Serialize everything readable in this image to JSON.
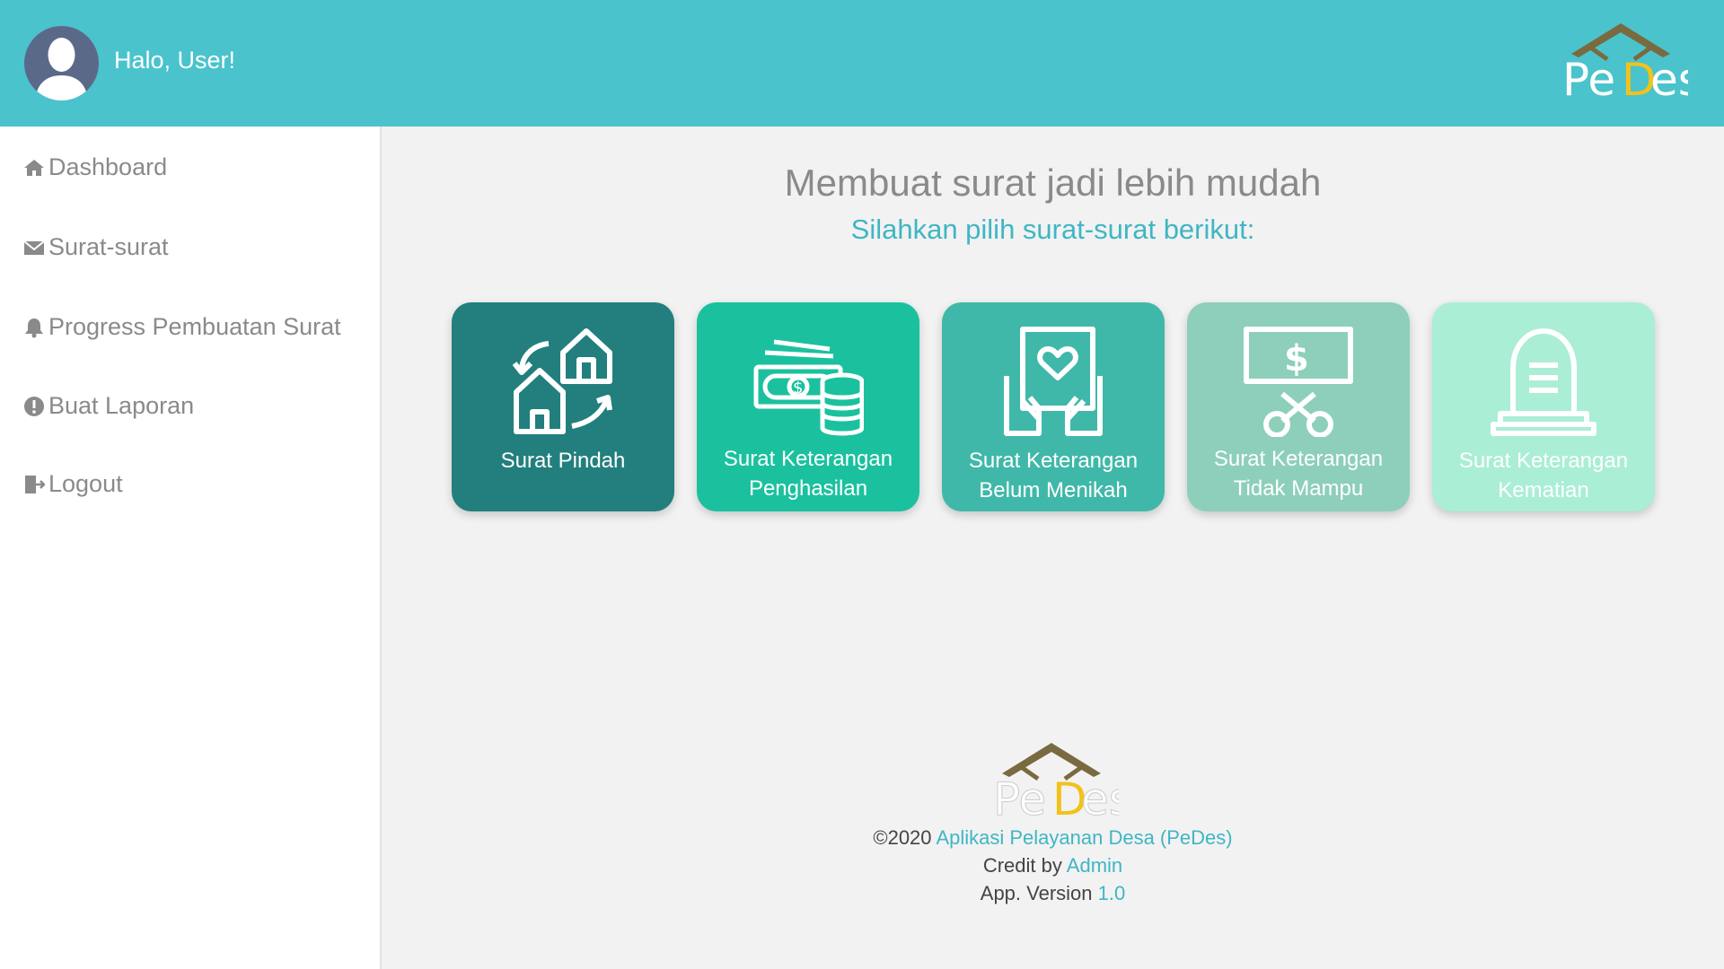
{
  "header": {
    "greeting": "Halo, User!",
    "logo_text": "PeDes"
  },
  "sidebar": {
    "items": [
      {
        "label": "Dashboard",
        "icon": "home-icon"
      },
      {
        "label": "Surat-surat",
        "icon": "envelope-icon"
      },
      {
        "label": "Progress Pembuatan Surat",
        "icon": "bell-icon"
      },
      {
        "label": "Buat Laporan",
        "icon": "exclamation-circle-icon"
      },
      {
        "label": "Logout",
        "icon": "logout-icon"
      }
    ]
  },
  "main": {
    "title": "Membuat surat jadi lebih mudah",
    "subtitle": "Silahkan pilih surat-surat berikut:",
    "cards": [
      {
        "line1": "Surat Pindah",
        "line2": "",
        "icon": "moving-house-icon",
        "color": "#227f7e"
      },
      {
        "line1": "Surat Keterangan",
        "line2": "Penghasilan",
        "icon": "money-icon",
        "color": "#1bc19e"
      },
      {
        "line1": "Surat Keterangan",
        "line2": "Belum Menikah",
        "icon": "love-letter-icon",
        "color": "#40b8a9"
      },
      {
        "line1": "Surat Keterangan",
        "line2": "Tidak Mampu",
        "icon": "cut-money-icon",
        "color": "#8dcfbb"
      },
      {
        "line1": "Surat Keterangan",
        "line2": "Kematian",
        "icon": "gravestone-icon",
        "color": "#aaeed6"
      }
    ]
  },
  "footer": {
    "copyright_prefix": "©2020",
    "app_name": "Aplikasi Pelayanan Desa (PeDes)",
    "credit_prefix": "Credit by",
    "credit_name": "Admin",
    "version_prefix": "App. Version",
    "version": "1.0"
  },
  "colors": {
    "header": "#4ac3cc",
    "accent": "#3fb6c4",
    "logo_roof": "#7a6a3f",
    "logo_yellow": "#f2c21a"
  }
}
